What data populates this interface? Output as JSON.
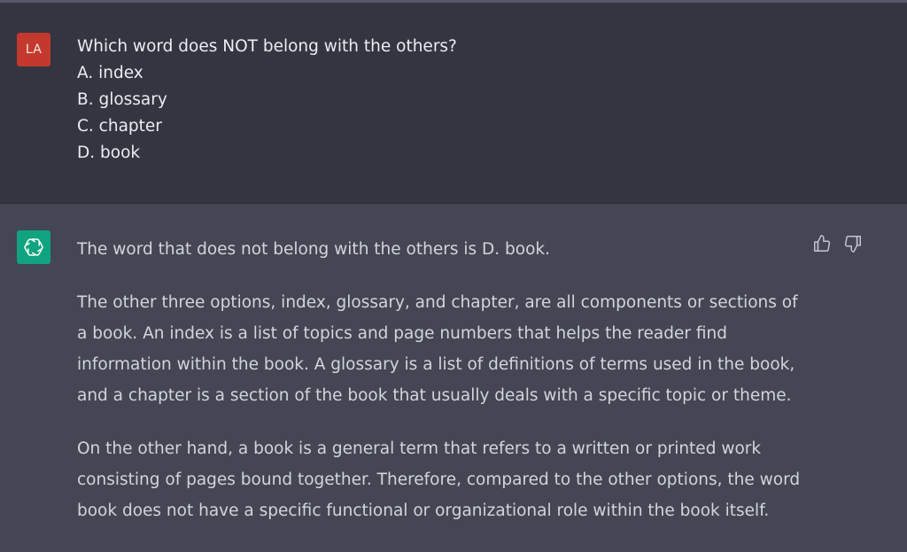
{
  "user_message": {
    "avatar_initials": "LA",
    "avatar_color": "#c4392d",
    "lines": [
      "Which word does NOT belong with the others?",
      "A. index",
      "B. glossary",
      "C. chapter",
      "D. book"
    ]
  },
  "assistant_message": {
    "avatar_icon": "openai-logo-icon",
    "avatar_color": "#10a37f",
    "paragraphs": [
      "The word that does not belong with the others is D. book.",
      "The other three options, index, glossary, and chapter, are all components or sections of a book. An index is a list of topics and page numbers that helps the reader find information within the book. A glossary is a list of definitions of terms used in the book, and a chapter is a section of the book that usually deals with a specific topic or theme.",
      "On the other hand, a book is a general term that refers to a written or printed work consisting of pages bound together. Therefore, compared to the other options, the word book does not have a specific functional or organizational role within the book itself."
    ],
    "feedback_icons": [
      "thumbs-up-icon",
      "thumbs-down-icon"
    ]
  }
}
